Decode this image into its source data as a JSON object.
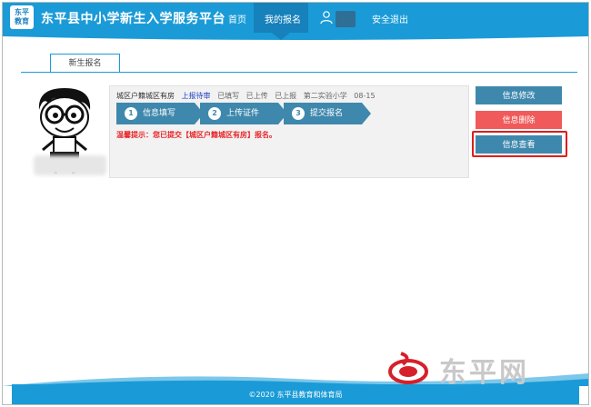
{
  "header": {
    "logo_text_line1": "东平",
    "logo_text_line2": "教育",
    "title": "东平县中小学新生入学服务平台",
    "nav": [
      {
        "label": "首页"
      },
      {
        "label": "我的报名"
      },
      {
        "label": "安全退出"
      }
    ],
    "active_nav": "我的报名"
  },
  "tab": {
    "label": "新生报名"
  },
  "application": {
    "category": "城区户籍城区有房",
    "status": "上报待审",
    "filled": "已填写",
    "uploaded": "已上传",
    "reported": "已上报",
    "school": "第二实验小学",
    "date": "08-15",
    "steps": [
      {
        "num": "1",
        "label": "信息填写"
      },
      {
        "num": "2",
        "label": "上传证件"
      },
      {
        "num": "3",
        "label": "提交报名"
      }
    ],
    "tip": "温馨提示：您已提交【城区户籍城区有房】报名。"
  },
  "actions": {
    "edit_label": "信息修改",
    "delete_label": "信息删除",
    "view_label": "信息查看"
  },
  "footer": {
    "text": "©2020  东平县教育和体育局"
  },
  "watermark": {
    "text": "东平网"
  },
  "colors": {
    "header_blue": "#1a9bd7",
    "button_blue": "#3f88ad",
    "button_red": "#f15a5a",
    "tip_red": "#e8262a",
    "highlight_red": "#e11c1c"
  }
}
